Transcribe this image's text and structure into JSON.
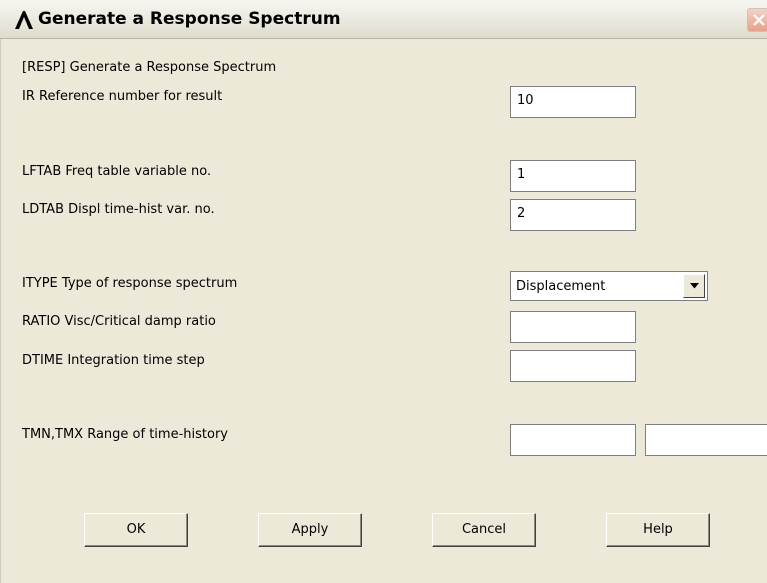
{
  "window": {
    "title": "Generate a Response Spectrum",
    "logo_icon": "ansys-lambda-icon",
    "close_icon": "close-icon"
  },
  "form": {
    "header": "[RESP]  Generate a Response Spectrum",
    "ir": {
      "label": "IR   Reference number for result",
      "value": "10"
    },
    "lftab": {
      "label": "LFTAB  Freq table variable no.",
      "value": "1"
    },
    "ldtab": {
      "label": "LDTAB  Displ time-hist var. no.",
      "value": "2"
    },
    "itype": {
      "label": "ITYPE  Type of response spectrum",
      "value": "Displacement"
    },
    "ratio": {
      "label": "RATIO  Visc/Critical damp ratio",
      "value": ""
    },
    "dtime": {
      "label": "DTIME  Integration time step",
      "value": ""
    },
    "tmn_tmx": {
      "label": "TMN,TMX  Range of time-history",
      "tmn": "",
      "tmx": ""
    }
  },
  "buttons": {
    "ok": "OK",
    "apply": "Apply",
    "cancel": "Cancel",
    "help": "Help"
  },
  "colors": {
    "dialog_bg": "#ece9d8",
    "logo": "#000000",
    "close_button": "#e8a08a"
  }
}
